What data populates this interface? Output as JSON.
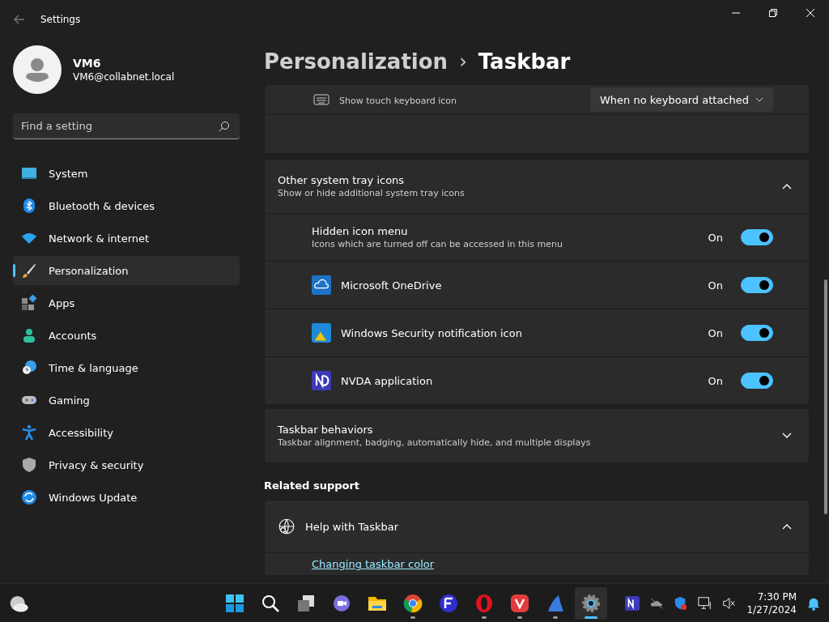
{
  "window": {
    "title": "Settings"
  },
  "user": {
    "name": "VM6",
    "email": "VM6@collabnet.local"
  },
  "search": {
    "placeholder": "Find a setting"
  },
  "sidebar": {
    "items": [
      {
        "label": "System",
        "kind": "system",
        "selected": false
      },
      {
        "label": "Bluetooth & devices",
        "kind": "bluetooth",
        "selected": false
      },
      {
        "label": "Network & internet",
        "kind": "network",
        "selected": false
      },
      {
        "label": "Personalization",
        "kind": "brush",
        "selected": true
      },
      {
        "label": "Apps",
        "kind": "apps",
        "selected": false
      },
      {
        "label": "Accounts",
        "kind": "accounts",
        "selected": false
      },
      {
        "label": "Time & language",
        "kind": "time",
        "selected": false
      },
      {
        "label": "Gaming",
        "kind": "gaming",
        "selected": false
      },
      {
        "label": "Accessibility",
        "kind": "accessibility",
        "selected": false
      },
      {
        "label": "Privacy & security",
        "kind": "privacy",
        "selected": false
      },
      {
        "label": "Windows Update",
        "kind": "update",
        "selected": false
      }
    ]
  },
  "breadcrumb": {
    "parent": "Personalization",
    "separator": "›",
    "current": "Taskbar"
  },
  "keyboard_row": {
    "subtitle": "Show touch keyboard icon",
    "value": "When no keyboard attached"
  },
  "tray_section": {
    "title": "Other system tray icons",
    "subtitle": "Show or hide additional system tray icons",
    "expanded": true,
    "rows": [
      {
        "title": "Hidden icon menu",
        "subtitle": "Icons which are turned off can be accessed in this menu",
        "kind": "plain",
        "state_label": "On",
        "on": true
      },
      {
        "title": "Microsoft OneDrive",
        "kind": "onedrive",
        "state_label": "On",
        "on": true
      },
      {
        "title": "Windows Security notification icon",
        "kind": "security",
        "state_label": "On",
        "on": true
      },
      {
        "title": "NVDA application",
        "kind": "nvda",
        "state_label": "On",
        "on": true
      }
    ]
  },
  "behaviors_section": {
    "title": "Taskbar behaviors",
    "subtitle": "Taskbar alignment, badging, automatically hide, and multiple displays",
    "expanded": false
  },
  "related": {
    "heading": "Related support",
    "help_title": "Help with Taskbar",
    "expanded": true,
    "link": "Changing taskbar color"
  },
  "taskbar": {
    "apps": [
      {
        "kind": "start",
        "running": false,
        "selected": false
      },
      {
        "kind": "search",
        "running": false,
        "selected": false
      },
      {
        "kind": "taskview",
        "running": false,
        "selected": false
      },
      {
        "kind": "chat",
        "running": false,
        "selected": false
      },
      {
        "kind": "explorer",
        "running": false,
        "selected": false
      },
      {
        "kind": "chrome",
        "running": true,
        "selected": false
      },
      {
        "kind": "fapp",
        "running": false,
        "selected": false
      },
      {
        "kind": "opera",
        "running": true,
        "selected": false
      },
      {
        "kind": "vivaldi",
        "running": true,
        "selected": false
      },
      {
        "kind": "bird",
        "running": true,
        "selected": false
      },
      {
        "kind": "settings",
        "running": true,
        "selected": true
      }
    ],
    "time": "7:30 PM",
    "date": "1/27/2024"
  }
}
